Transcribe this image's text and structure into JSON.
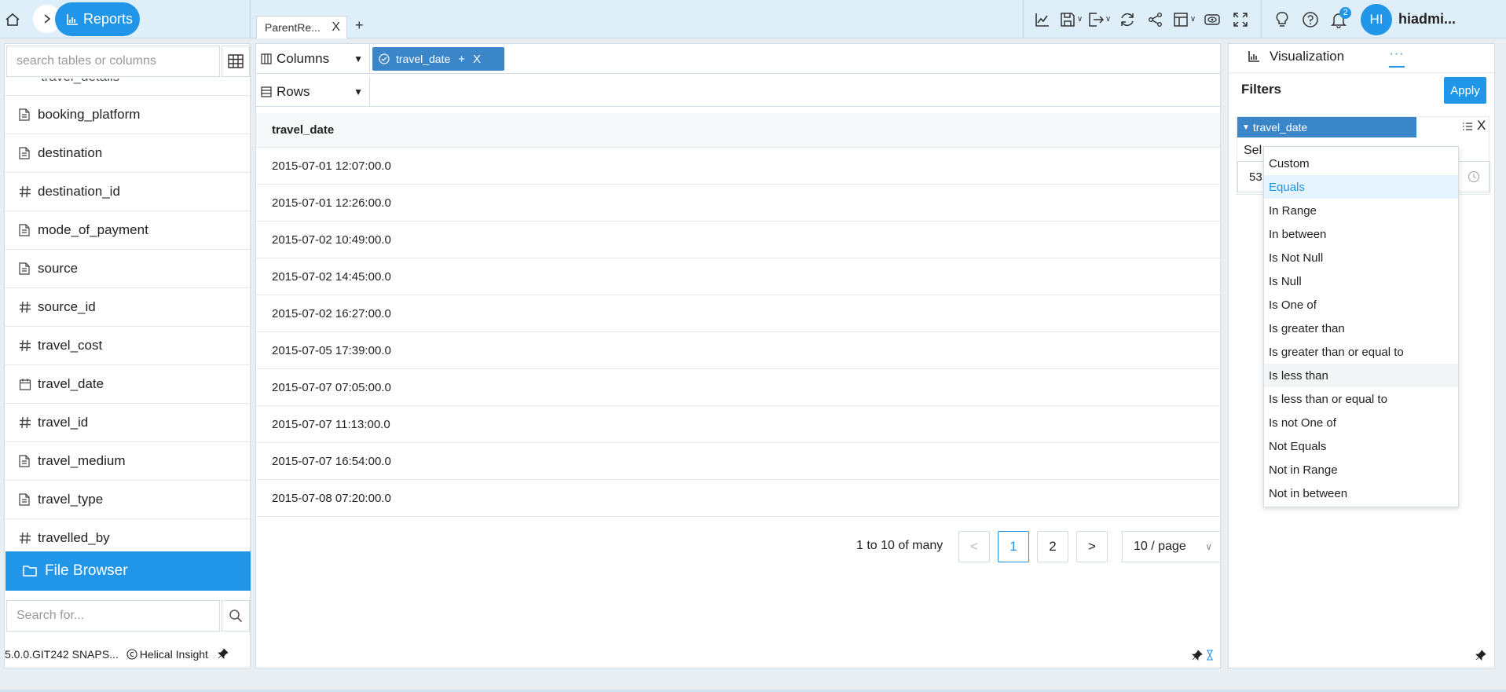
{
  "header": {
    "breadcrumb_label": "Reports",
    "doc_tab_label": "ParentRe...",
    "doc_tab_close": "X",
    "add_tab": "+",
    "notification_count": "2",
    "user_initials": "HI",
    "username": "hiadmi..."
  },
  "left_panel": {
    "search_placeholder": "search tables or columns",
    "partial_item": "travel_details",
    "fields": [
      {
        "name": "booking_platform",
        "icon": "text-field-icon"
      },
      {
        "name": "destination",
        "icon": "text-field-icon"
      },
      {
        "name": "destination_id",
        "icon": "hash-icon"
      },
      {
        "name": "mode_of_payment",
        "icon": "text-field-icon"
      },
      {
        "name": "source",
        "icon": "text-field-icon"
      },
      {
        "name": "source_id",
        "icon": "hash-icon"
      },
      {
        "name": "travel_cost",
        "icon": "hash-icon"
      },
      {
        "name": "travel_date",
        "icon": "calendar-icon"
      },
      {
        "name": "travel_id",
        "icon": "hash-icon"
      },
      {
        "name": "travel_medium",
        "icon": "text-field-icon"
      },
      {
        "name": "travel_type",
        "icon": "text-field-icon"
      },
      {
        "name": "travelled_by",
        "icon": "hash-icon"
      }
    ],
    "file_browser_label": "File Browser",
    "search_for_placeholder": "Search for...",
    "version": "5.0.0.GIT242 SNAPS...",
    "brand": "Helical Insight"
  },
  "center": {
    "columns_label": "Columns",
    "rows_label": "Rows",
    "column_pill": "travel_date",
    "column_pill_plus": "+",
    "column_pill_close": "X",
    "table": {
      "header": "travel_date",
      "rows": [
        "2015-07-01 12:07:00.0",
        "2015-07-01 12:26:00.0",
        "2015-07-02 10:49:00.0",
        "2015-07-02 14:45:00.0",
        "2015-07-02 16:27:00.0",
        "2015-07-05 17:39:00.0",
        "2015-07-07 07:05:00.0",
        "2015-07-07 11:13:00.0",
        "2015-07-07 16:54:00.0",
        "2015-07-08 07:20:00.0"
      ]
    },
    "pager": {
      "range_text": "1 to 10 of many",
      "prev": "<",
      "pages": [
        "1",
        "2"
      ],
      "active_page": "1",
      "next": ">",
      "page_size": "10 / page"
    }
  },
  "right_panel": {
    "viz_tab_label": "Visualization",
    "more_tab_label": "···",
    "filters_title": "Filters",
    "apply_label": "Apply",
    "filter_field": "travel_date",
    "filter_close": "X",
    "select_label": "Sel",
    "filter_value": "53"
  },
  "operator_dropdown": {
    "selected": "Equals",
    "hovered": "Is less than",
    "options": [
      "Custom",
      "Equals",
      "In Range",
      "In between",
      "Is Not Null",
      "Is Null",
      "Is One of",
      "Is greater than",
      "Is greater than or equal to",
      "Is less than",
      "Is less than or equal to",
      "Is not One of",
      "Not Equals",
      "Not in Range",
      "Not in between"
    ]
  },
  "colors": {
    "accent": "#2196e8",
    "pill": "#3a86c8",
    "topbar": "#dfeff9"
  }
}
